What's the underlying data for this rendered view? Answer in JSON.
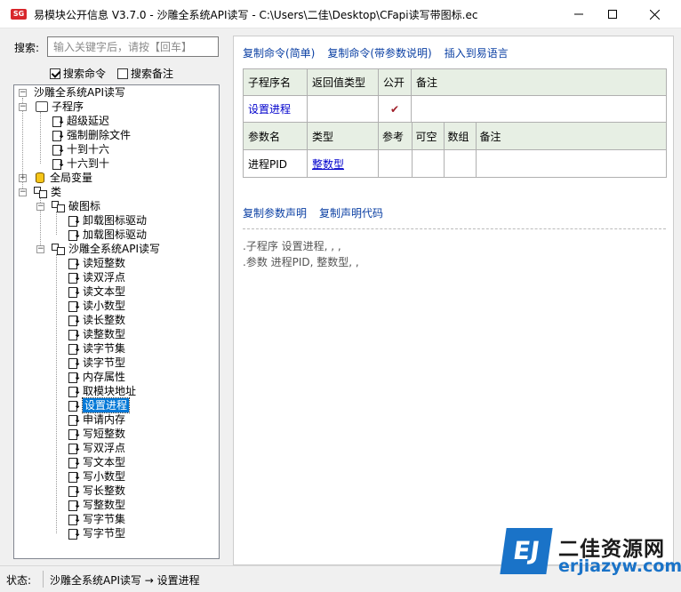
{
  "window": {
    "title": "易模块公开信息 V3.7.0 - 沙雕全系统API读写 - C:\\Users\\二佳\\Desktop\\CFapi读写带图标.ec",
    "icon": "app-logo-icon"
  },
  "search": {
    "label": "搜索:",
    "placeholder": "输入关键字后，请按【回车】",
    "value": "",
    "opt_commands": {
      "label": "搜索命令",
      "checked": true
    },
    "opt_notes": {
      "label": "搜索备注",
      "checked": false
    }
  },
  "tree": {
    "root": "沙雕全系统API读写",
    "subroutines_group": "子程序",
    "subroutines": [
      "超级延迟",
      "强制删除文件",
      "十到十六",
      "十六到十"
    ],
    "globals": "全局变量",
    "classes": "类",
    "class1": {
      "name": "破图标",
      "methods": [
        "卸载图标驱动",
        "加载图标驱动"
      ]
    },
    "class2": {
      "name": "沙雕全系统API读写",
      "methods": [
        "读短整数",
        "读双浮点",
        "读文本型",
        "读小数型",
        "读长整数",
        "读整数型",
        "读字节集",
        "读字节型",
        "内存属性",
        "取模块地址",
        "设置进程",
        "申请内存",
        "写短整数",
        "写双浮点",
        "写文本型",
        "写小数型",
        "写长整数",
        "写整数型",
        "写字节集",
        "写字节型"
      ],
      "selected": "设置进程"
    }
  },
  "actions": {
    "copy_simple": "复制命令(简单)",
    "copy_with_params": "复制命令(带参数说明)",
    "insert_to_e": "插入到易语言",
    "copy_param_decl": "复制参数声明",
    "copy_decl_code": "复制声明代码"
  },
  "sub_table": {
    "headers": [
      "子程序名",
      "返回值类型",
      "公开",
      "备注"
    ],
    "row": {
      "name": "设置进程",
      "return_type": "",
      "public": "✔",
      "note": ""
    }
  },
  "param_table": {
    "headers": [
      "参数名",
      "类型",
      "参考",
      "可空",
      "数组",
      "备注"
    ],
    "row": {
      "name": "进程PID",
      "type": "整数型",
      "ref": "",
      "nullable": "",
      "array": "",
      "note": ""
    }
  },
  "code": {
    "line1": ".子程序 设置进程, , ,",
    "line2": ".参数 进程PID, 整数型, ,"
  },
  "status": {
    "label": "状态:",
    "text": "沙雕全系统API读写 → 设置进程"
  },
  "watermark": {
    "logo": "EJ",
    "name": "二佳资源网",
    "url": "erjiazyw.com"
  },
  "colors": {
    "accent": "#0078d7",
    "link": "#0a3fa3",
    "table_header": "#e7efe4",
    "watermark_blue": "#1a73c8"
  }
}
